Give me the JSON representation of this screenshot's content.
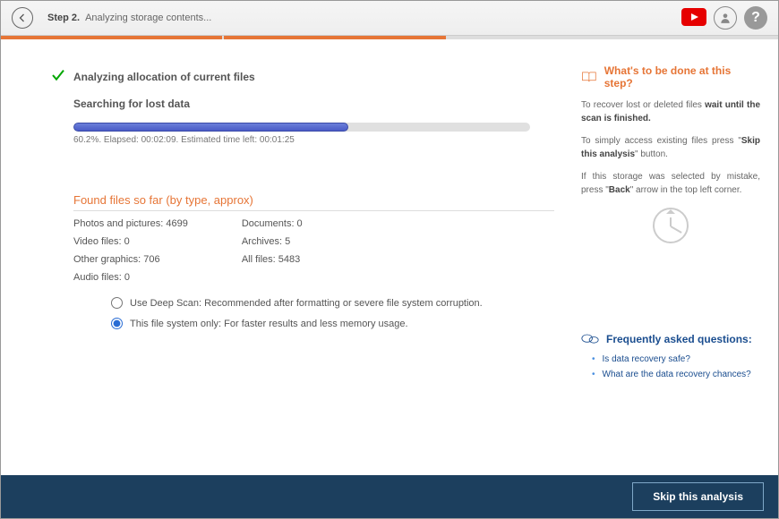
{
  "header": {
    "step_label": "Step 2.",
    "title": "Analyzing storage contents..."
  },
  "status": {
    "main_title": "Analyzing allocation of current files",
    "sub_title": "Searching for lost data"
  },
  "progress": {
    "percent": 60.2,
    "elapsed": "00:02:09",
    "remaining": "00:01:25",
    "text": "60.2%. Elapsed: 00:02:09. Estimated time left: 00:01:25"
  },
  "found": {
    "title": "Found files so far (by type, approx)",
    "col1": [
      {
        "label": "Photos and pictures",
        "value": 4699
      },
      {
        "label": "Video files",
        "value": 0
      },
      {
        "label": "Other graphics",
        "value": 706
      },
      {
        "label": "Audio files",
        "value": 0
      }
    ],
    "col2": [
      {
        "label": "Documents",
        "value": 0
      },
      {
        "label": "Archives",
        "value": 5
      },
      {
        "label": "All files",
        "value": 5483
      }
    ]
  },
  "scan_options": {
    "deep": "Use Deep Scan: Recommended after formatting or severe file system corruption.",
    "fsonly": "This file system only: For faster results and less memory usage.",
    "selected": "fsonly"
  },
  "sidebar": {
    "help_title": "What's to be done at this step?",
    "p1_prefix": "To recover lost or deleted files ",
    "p1_bold": "wait until the scan is finished.",
    "p2_prefix": "To simply access existing files press \"",
    "p2_bold": "Skip this analysis",
    "p2_suffix": "\" button.",
    "p3_prefix": "If this storage was selected by mistake, press \"",
    "p3_bold": "Back",
    "p3_suffix": "\" arrow in the top left corner.",
    "faq_title": "Frequently asked questions:",
    "faqs": [
      "Is data recovery safe?",
      "What are the data recovery chances?"
    ]
  },
  "footer": {
    "skip_label": "Skip this analysis"
  }
}
